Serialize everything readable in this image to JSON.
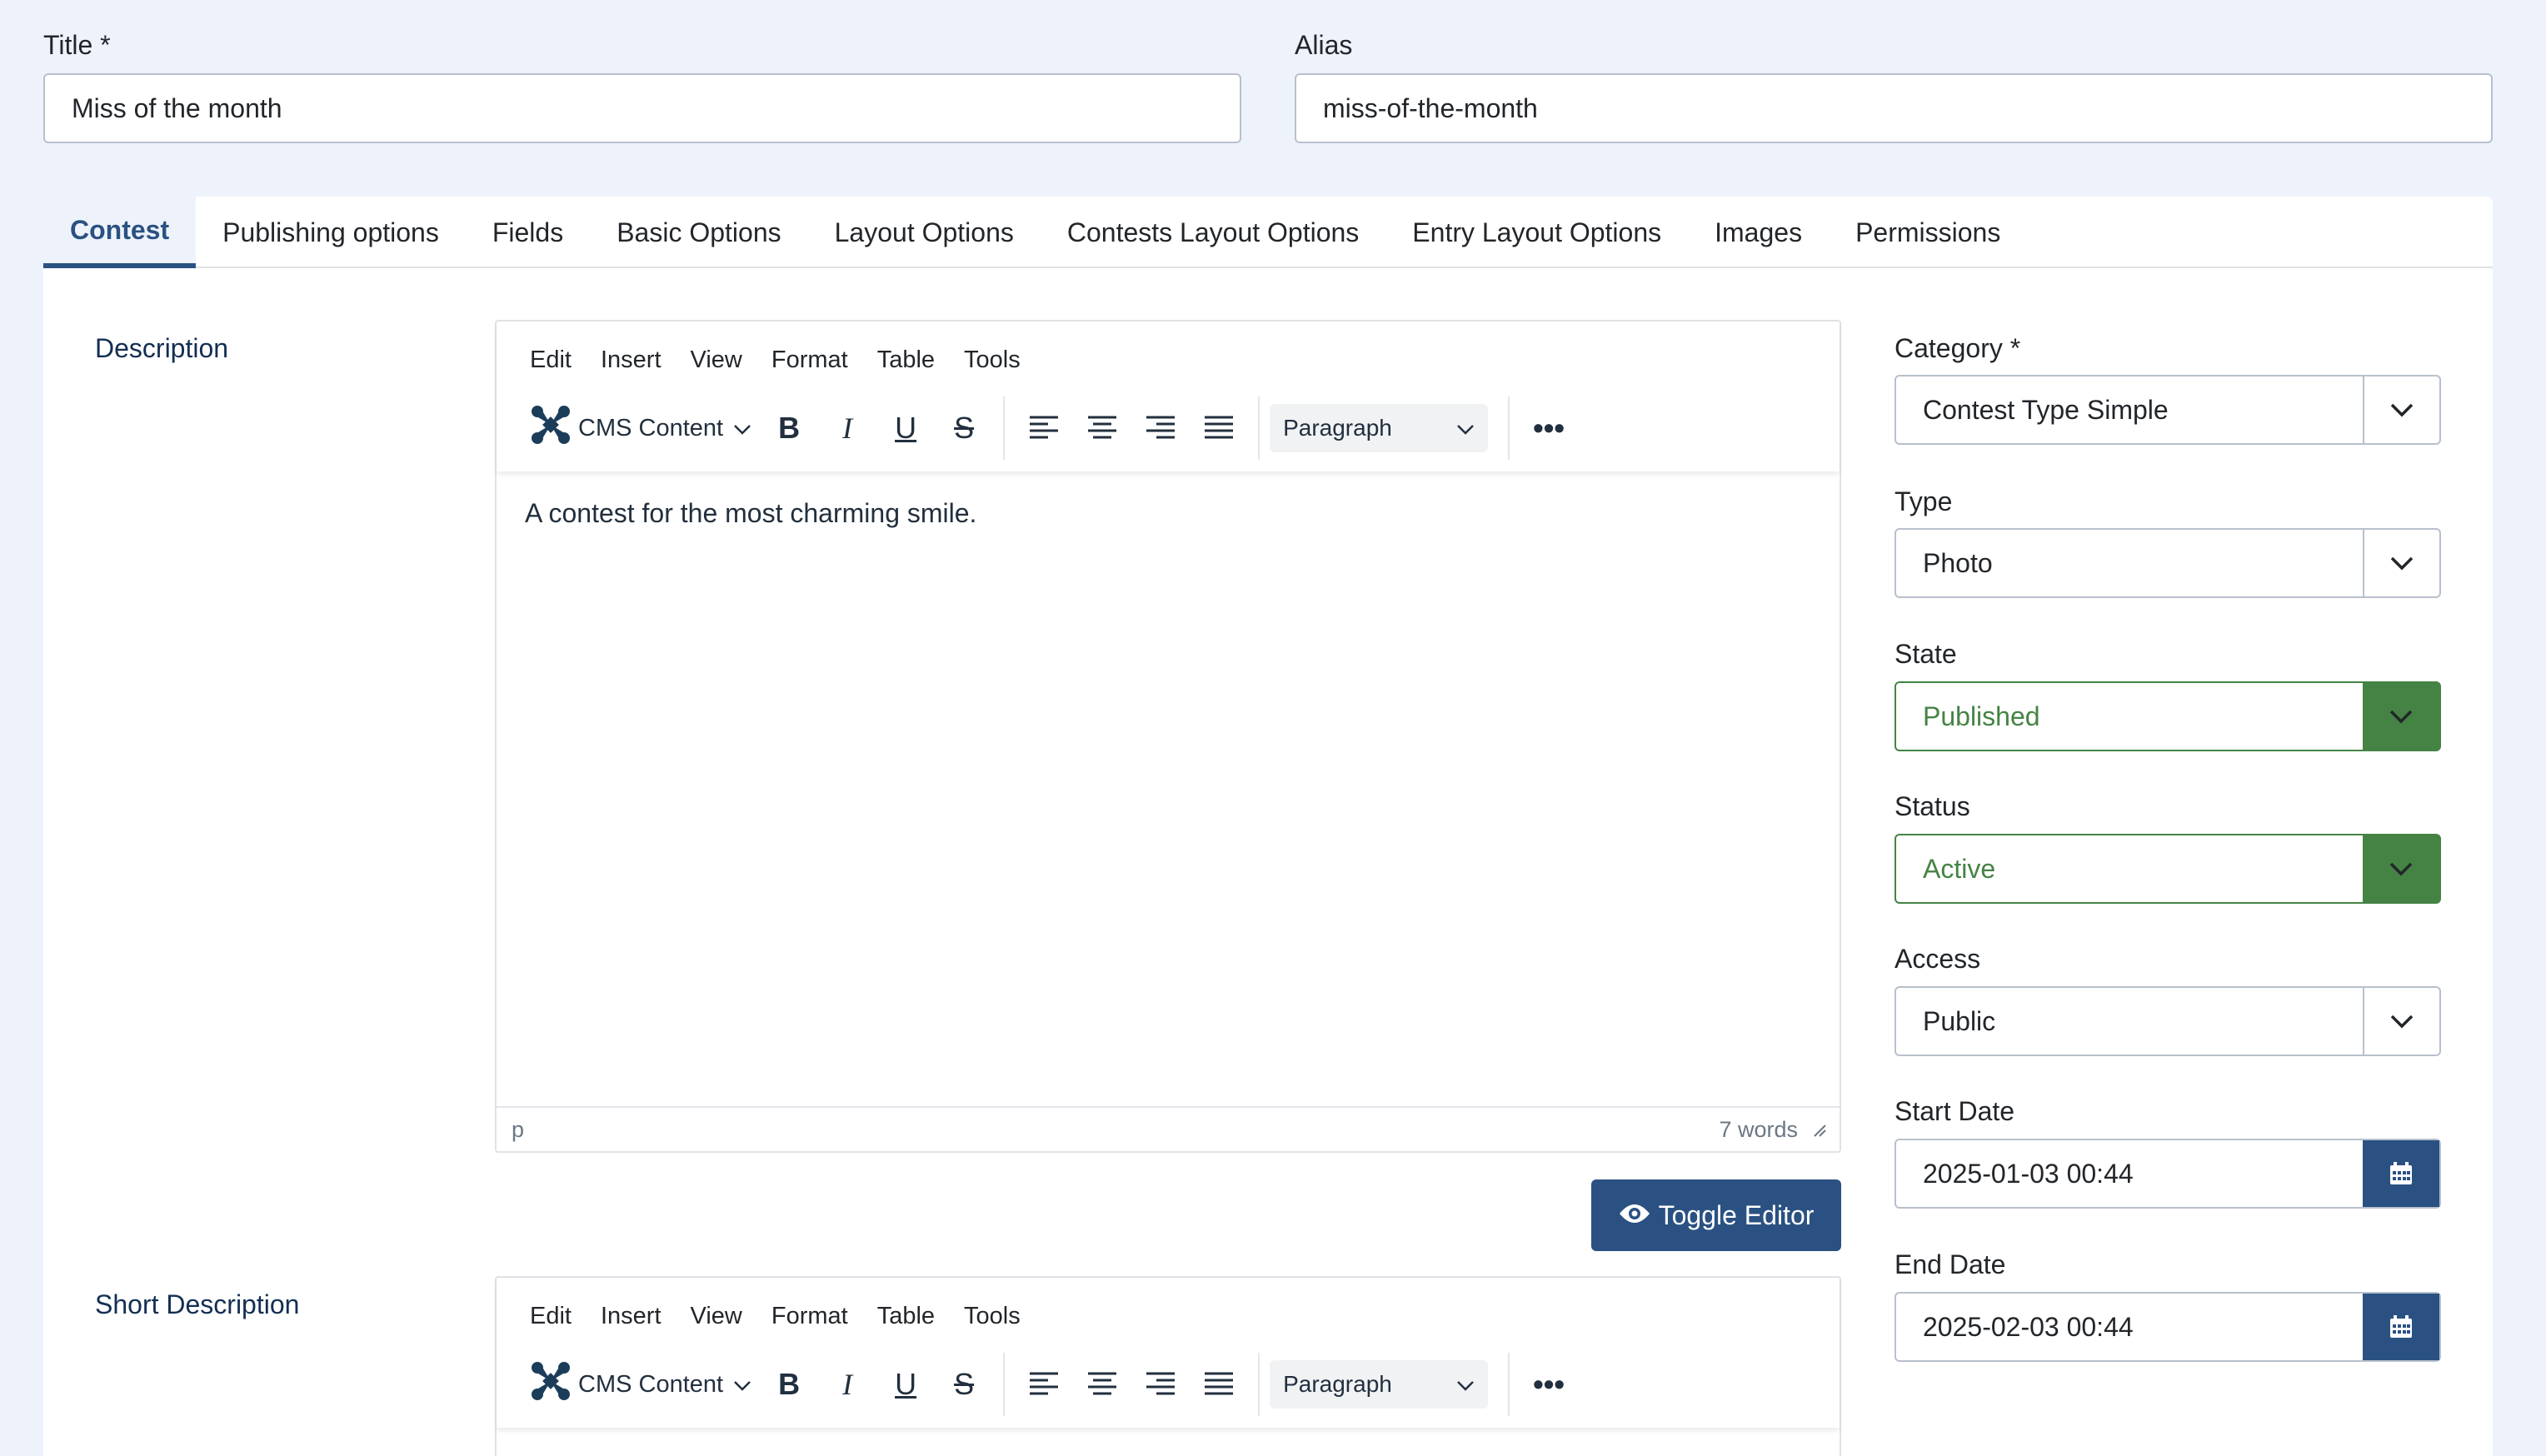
{
  "title_field": {
    "label": "Title *",
    "value": "Miss of the month"
  },
  "alias_field": {
    "label": "Alias",
    "value": "miss-of-the-month"
  },
  "tabs": [
    {
      "label": "Contest"
    },
    {
      "label": "Publishing options"
    },
    {
      "label": "Fields"
    },
    {
      "label": "Basic Options"
    },
    {
      "label": "Layout Options"
    },
    {
      "label": "Contests Layout Options"
    },
    {
      "label": "Entry Layout Options"
    },
    {
      "label": "Images"
    },
    {
      "label": "Permissions"
    }
  ],
  "description": {
    "label": "Description",
    "menu": [
      "Edit",
      "Insert",
      "View",
      "Format",
      "Table",
      "Tools"
    ],
    "cms_label": "CMS Content",
    "format_select": "Paragraph",
    "content": "A contest for the most charming smile.",
    "path": "p",
    "word_count": "7 words"
  },
  "toggle_editor": {
    "label": "Toggle Editor"
  },
  "short_description": {
    "label": "Short Description",
    "menu": [
      "Edit",
      "Insert",
      "View",
      "Format",
      "Table",
      "Tools"
    ],
    "cms_label": "CMS Content",
    "format_select": "Paragraph"
  },
  "sidebar": {
    "category": {
      "label": "Category *",
      "value": "Contest Type Simple"
    },
    "type": {
      "label": "Type",
      "value": "Photo"
    },
    "state": {
      "label": "State",
      "value": "Published"
    },
    "status": {
      "label": "Status",
      "value": "Active"
    },
    "access": {
      "label": "Access",
      "value": "Public"
    },
    "start_date": {
      "label": "Start Date",
      "value": "2025-01-03 00:44"
    },
    "end_date": {
      "label": "End Date",
      "value": "2025-02-03 00:44"
    }
  },
  "colors": {
    "primary": "#2a5182",
    "success": "#448344",
    "background": "#eef3fb"
  }
}
